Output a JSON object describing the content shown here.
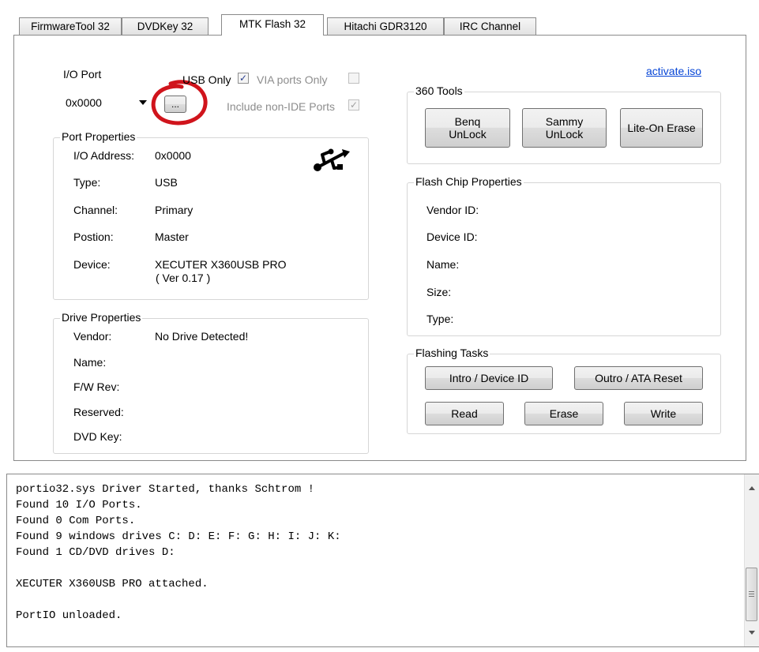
{
  "tabs": [
    "FirmwareTool 32",
    "DVDKey 32",
    "MTK Flash 32",
    "Hitachi GDR3120",
    "IRC Channel"
  ],
  "active_tab": "MTK Flash 32",
  "io_port": {
    "label": "I/O Port",
    "value": "0x0000",
    "browse_label": "...",
    "usb_only_label": "USB Only",
    "usb_only_checked": true,
    "via_ports_label": "VIA ports Only",
    "non_ide_label": "Include non-IDE Ports"
  },
  "activate_link": "activate.iso",
  "port_properties": {
    "title": "Port Properties",
    "rows": [
      {
        "label": "I/O Address:",
        "value": "0x0000"
      },
      {
        "label": "Type:",
        "value": "USB"
      },
      {
        "label": "Channel:",
        "value": "Primary"
      },
      {
        "label": "Postion:",
        "value": "Master"
      },
      {
        "label": "Device:",
        "value": "XECUTER X360USB PRO"
      }
    ],
    "device_version": "( Ver 0.17 )",
    "icon": "usb-icon"
  },
  "drive_properties": {
    "title": "Drive Properties",
    "rows": [
      {
        "label": "Vendor:",
        "value": "No Drive Detected!"
      },
      {
        "label": "Name:",
        "value": ""
      },
      {
        "label": "F/W Rev:",
        "value": ""
      },
      {
        "label": "Reserved:",
        "value": ""
      },
      {
        "label": "DVD Key:",
        "value": ""
      }
    ]
  },
  "tools_360": {
    "title": "360 Tools",
    "buttons": [
      "Benq\nUnLock",
      "Sammy\nUnLock",
      "Lite-On Erase"
    ]
  },
  "flash_chip": {
    "title": "Flash Chip Properties",
    "rows": [
      "Vendor ID:",
      "Device ID:",
      "Name:",
      "Size:",
      "Type:"
    ]
  },
  "flashing_tasks": {
    "title": "Flashing Tasks",
    "intro_label": "Intro / Device ID",
    "outro_label": "Outro / ATA Reset",
    "read_label": "Read",
    "erase_label": "Erase",
    "write_label": "Write"
  },
  "log": {
    "text": "portio32.sys Driver Started, thanks Schtrom !\nFound 10 I/O Ports.\nFound 0 Com Ports.\nFound 9 windows drives C: D: E: F: G: H: I: J: K:\nFound 1 CD/DVD drives D:\n\nXECUTER X360USB PRO attached.\n\nPortIO unloaded."
  },
  "colors": {
    "link": "#0645d6",
    "highlight_circle": "#d0141c"
  }
}
